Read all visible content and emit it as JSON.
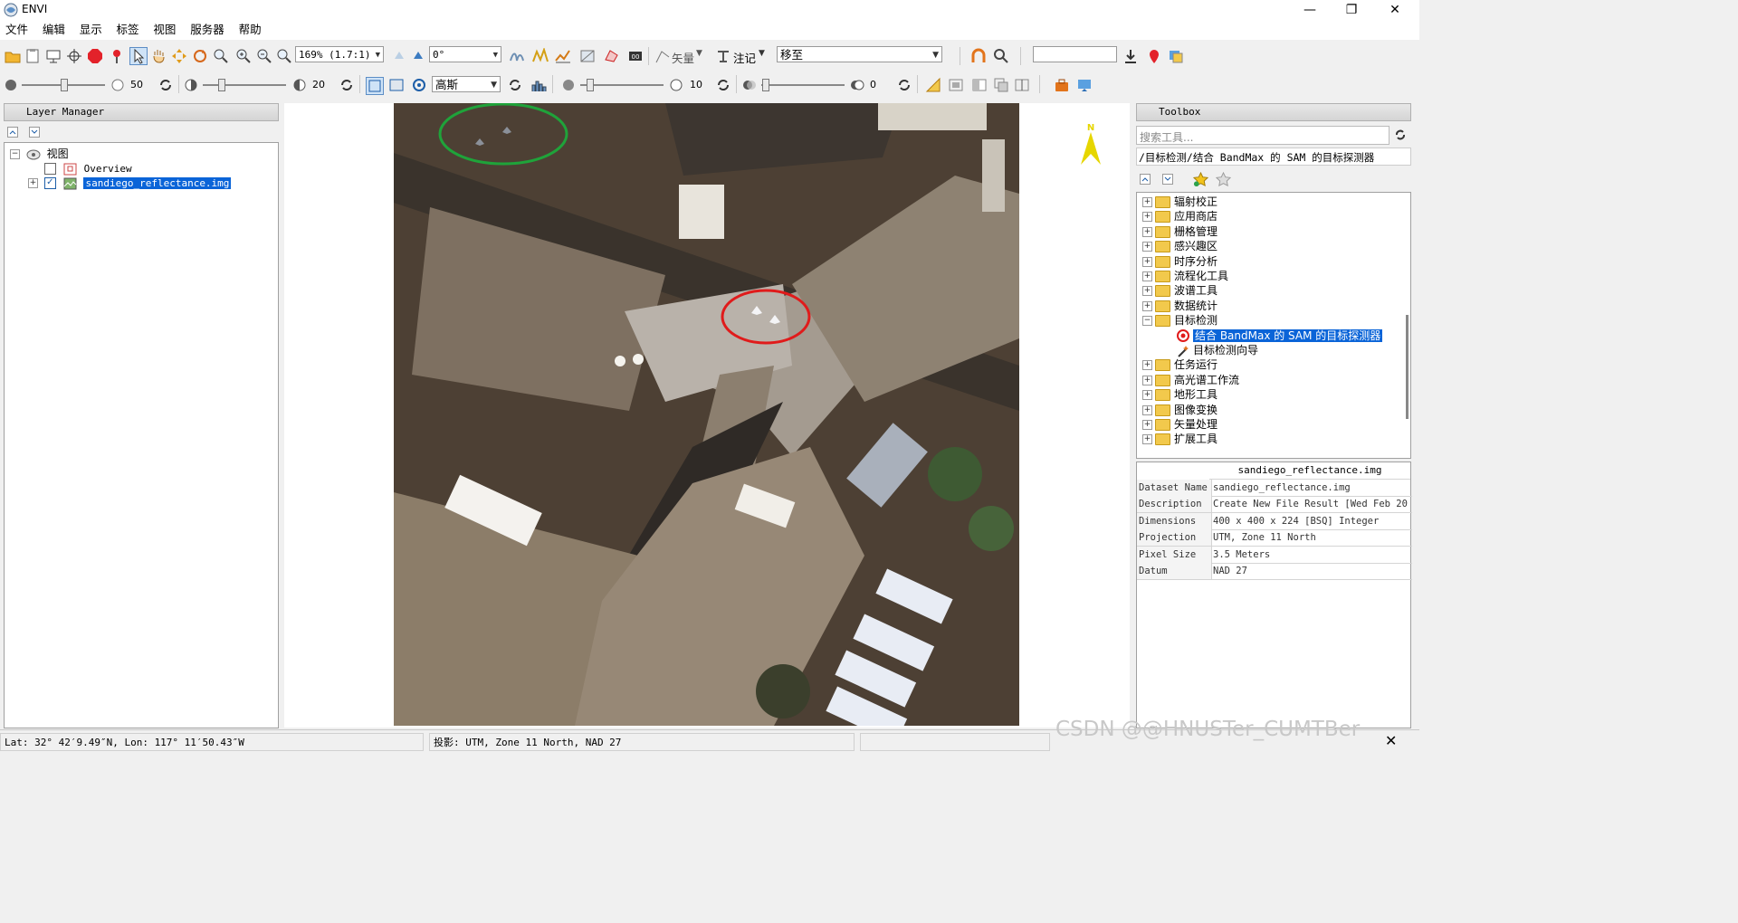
{
  "window": {
    "title": "ENVI",
    "controls": [
      "—",
      "❐",
      "✕"
    ]
  },
  "menu": [
    "文件",
    "编辑",
    "显示",
    "标签",
    "视图",
    "服务器",
    "帮助"
  ],
  "toolbar1": {
    "zoom_value": "169% (1.7:1)",
    "rotation_value": "0°",
    "vector_label": "矢量",
    "annotation_label": "注记",
    "goto_value": "移至",
    "search_value": ""
  },
  "toolbar2": {
    "brightness_value": "50",
    "contrast_value": "20",
    "stretch_value": "高斯",
    "sharpen_value": "10",
    "transparency_value": "0"
  },
  "layer_manager": {
    "title": "Layer Manager",
    "root_label": "视图",
    "items": [
      {
        "label": "Overview",
        "checked": false
      },
      {
        "label": "sandiego_reflectance.img",
        "checked": true,
        "selected": true
      }
    ]
  },
  "north_arrow_label": "N",
  "toolbox": {
    "title": "Toolbox",
    "search_placeholder": "搜索工具...",
    "path": "/目标检测/结合 BandMax 的 SAM 的目标探测器",
    "categories": [
      {
        "label": "辐射校正",
        "expanded": false
      },
      {
        "label": "应用商店",
        "expanded": false
      },
      {
        "label": "栅格管理",
        "expanded": false
      },
      {
        "label": "感兴趣区",
        "expanded": false
      },
      {
        "label": "时序分析",
        "expanded": false
      },
      {
        "label": "流程化工具",
        "expanded": false
      },
      {
        "label": "波谱工具",
        "expanded": false
      },
      {
        "label": "数据统计",
        "expanded": false
      },
      {
        "label": "目标检测",
        "expanded": true
      },
      {
        "label": "任务运行",
        "expanded": false
      },
      {
        "label": "高光谱工作流",
        "expanded": false
      },
      {
        "label": "地形工具",
        "expanded": false
      },
      {
        "label": "图像变换",
        "expanded": false
      },
      {
        "label": "矢量处理",
        "expanded": false
      },
      {
        "label": "扩展工具",
        "expanded": false
      }
    ],
    "children": [
      {
        "label": "结合 BandMax 的 SAM 的目标探测器",
        "selected": true,
        "icon": "target-icon"
      },
      {
        "label": "目标检测向导",
        "selected": false,
        "icon": "wand-icon"
      }
    ]
  },
  "metadata": {
    "header": "sandiego_reflectance.img",
    "rows": [
      {
        "key": "Dataset Name",
        "value": "sandiego_reflectance.img"
      },
      {
        "key": "Description",
        "value": "Create New File Result [Wed Feb 20 0"
      },
      {
        "key": "Dimensions",
        "value": "400 x 400 x 224 [BSQ] Integer"
      },
      {
        "key": "Projection",
        "value": "UTM, Zone 11 North"
      },
      {
        "key": "Pixel Size",
        "value": "3.5 Meters"
      },
      {
        "key": "Datum",
        "value": "NAD 27"
      }
    ]
  },
  "status": {
    "latlon": "Lat: 32° 42′9.49″N, Lon: 117° 11′50.43″W",
    "projection": "投影:  UTM, Zone 11 North, NAD 27",
    "watermark": "CSDN @@HNUSTer_CUMTBer"
  },
  "colors": {
    "selection": "#0a64d8",
    "green_circle": "#1fa33a",
    "red_circle": "#e01b1b",
    "north_arrow": "#e6d600"
  }
}
